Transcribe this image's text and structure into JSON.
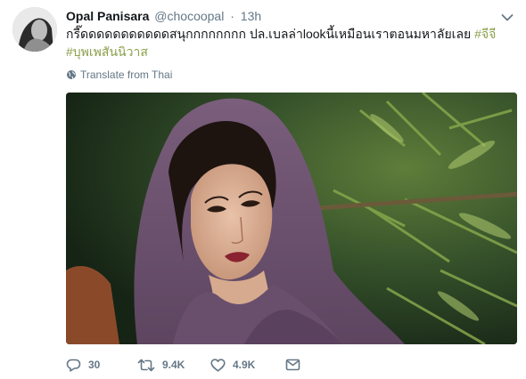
{
  "tweet": {
    "author_name": "Opal Panisara",
    "author_handle": "@chocoopal",
    "separator": "·",
    "time_ago": "13h",
    "text": "กรี๊ดดดดดดดดดดดสนุกกกกกกกก ปล.เบลล่าlookนี้เหมือนเราตอนมหาลัยเลย ",
    "hashtags": [
      "#จีจี",
      "#บุพเพสันนิวาส"
    ],
    "translate_label": "Translate from Thai"
  },
  "actions": {
    "reply_count": "30",
    "retweet_count": "9.4K",
    "like_count": "4.9K"
  },
  "colors": {
    "hashtag": "#8aa14c",
    "muted": "#657786",
    "text": "#14171a"
  },
  "icons": {
    "reply": "reply-icon",
    "retweet": "retweet-icon",
    "like": "heart-icon",
    "dm": "envelope-icon",
    "more": "chevron-down-icon",
    "translate": "globe-icon"
  }
}
